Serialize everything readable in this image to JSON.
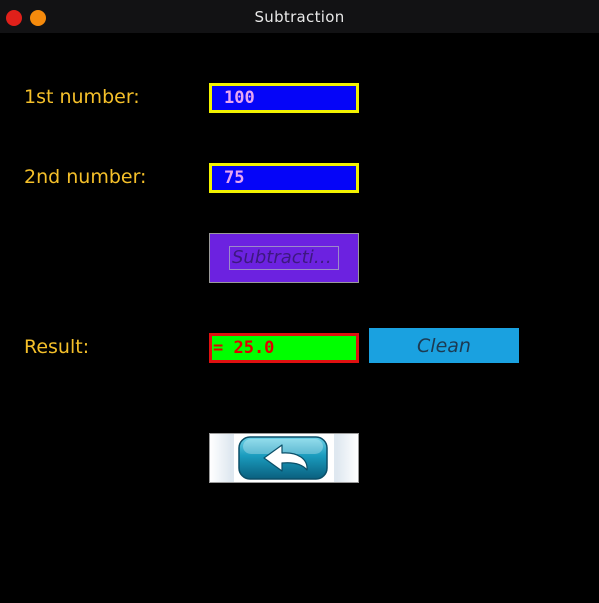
{
  "window": {
    "title": "Subtraction"
  },
  "form": {
    "first_label": "1st number:",
    "first_value": "100",
    "second_label": "2nd number:",
    "second_value": "75",
    "result_label": "Result:",
    "result_value": "= 25.0"
  },
  "buttons": {
    "subtract_label": "Subtraction",
    "clean_label": "Clean",
    "back_icon": "back-arrow-icon"
  },
  "colors": {
    "label_text": "#f5c02a",
    "input_bg": "#0505f8",
    "input_border": "#f2f200",
    "input_text": "#e6a6f2",
    "result_bg": "#00ff00",
    "result_border": "#e01010",
    "result_text": "#e00000",
    "subtract_bg": "#6c22e0",
    "clean_bg": "#1aa1e0",
    "close_dot": "#e0201a",
    "minimize_dot": "#f58a0c"
  }
}
